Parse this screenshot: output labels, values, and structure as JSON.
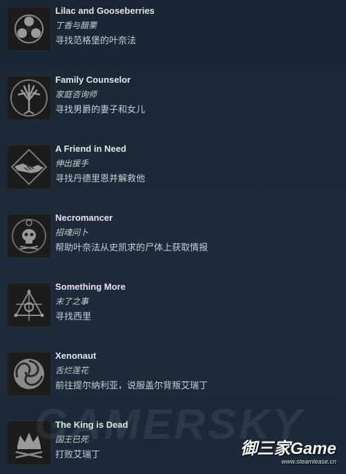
{
  "achievements": [
    {
      "title": "Lilac and Gooseberries",
      "subtitle": "丁香与醋栗",
      "description": "寻找范格堡的叶奈法",
      "icon": "tri-circle-icon"
    },
    {
      "title": "Family Counselor",
      "subtitle": "家庭咨询师",
      "description": "寻找男爵的妻子和女儿",
      "icon": "tree-icon"
    },
    {
      "title": "A Friend in Need",
      "subtitle": "伸出援手",
      "description": "寻找丹德里恩并解救他",
      "icon": "handshake-icon"
    },
    {
      "title": "Necromancer",
      "subtitle": "招魂问卜",
      "description": "帮助叶奈法从史凯求的尸体上获取情报",
      "icon": "skull-icon"
    },
    {
      "title": "Something More",
      "subtitle": "末了之事",
      "description": "寻找西里",
      "icon": "sigil-icon"
    },
    {
      "title": "Xenonaut",
      "subtitle": "舌烂莲花",
      "description": "前往提尔纳利亚，说服盖尔背叛艾瑞丁",
      "icon": "spiral-icon"
    },
    {
      "title": "The King is Dead",
      "subtitle": "国王已死",
      "description": "打败艾瑞丁",
      "icon": "crown-icon"
    }
  ],
  "watermark": "GAMERSKY",
  "logo": {
    "main": "御三家Game",
    "sub": "www.steamlease.cn"
  }
}
